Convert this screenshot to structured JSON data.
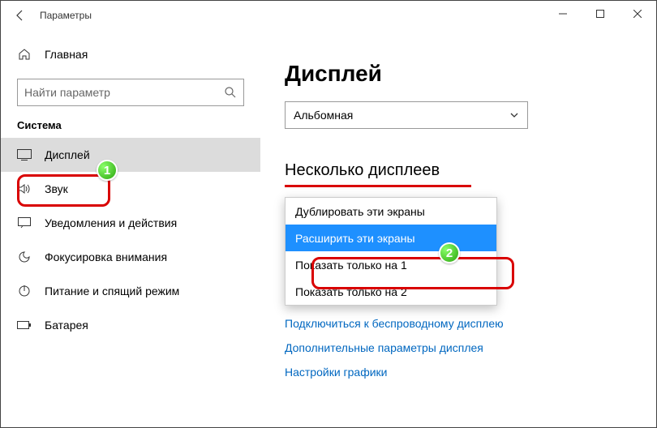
{
  "window": {
    "title": "Параметры"
  },
  "sidebar": {
    "home": "Главная",
    "search_placeholder": "Найти параметр",
    "category": "Система",
    "items": [
      {
        "label": "Дисплей"
      },
      {
        "label": "Звук"
      },
      {
        "label": "Уведомления и действия"
      },
      {
        "label": "Фокусировка внимания"
      },
      {
        "label": "Питание и спящий режим"
      },
      {
        "label": "Батарея"
      }
    ]
  },
  "main": {
    "heading": "Дисплей",
    "orientation": "Альбомная",
    "section": "Несколько дисплеев",
    "dropdown": [
      "Дублировать эти экраны",
      "Расширить эти экраны",
      "Показать только на 1",
      "Показать только на 2"
    ],
    "links": [
      "Подключиться к беспроводному дисплею",
      "Дополнительные параметры дисплея",
      "Настройки графики"
    ]
  },
  "annotations": {
    "badge1": "1",
    "badge2": "2"
  }
}
